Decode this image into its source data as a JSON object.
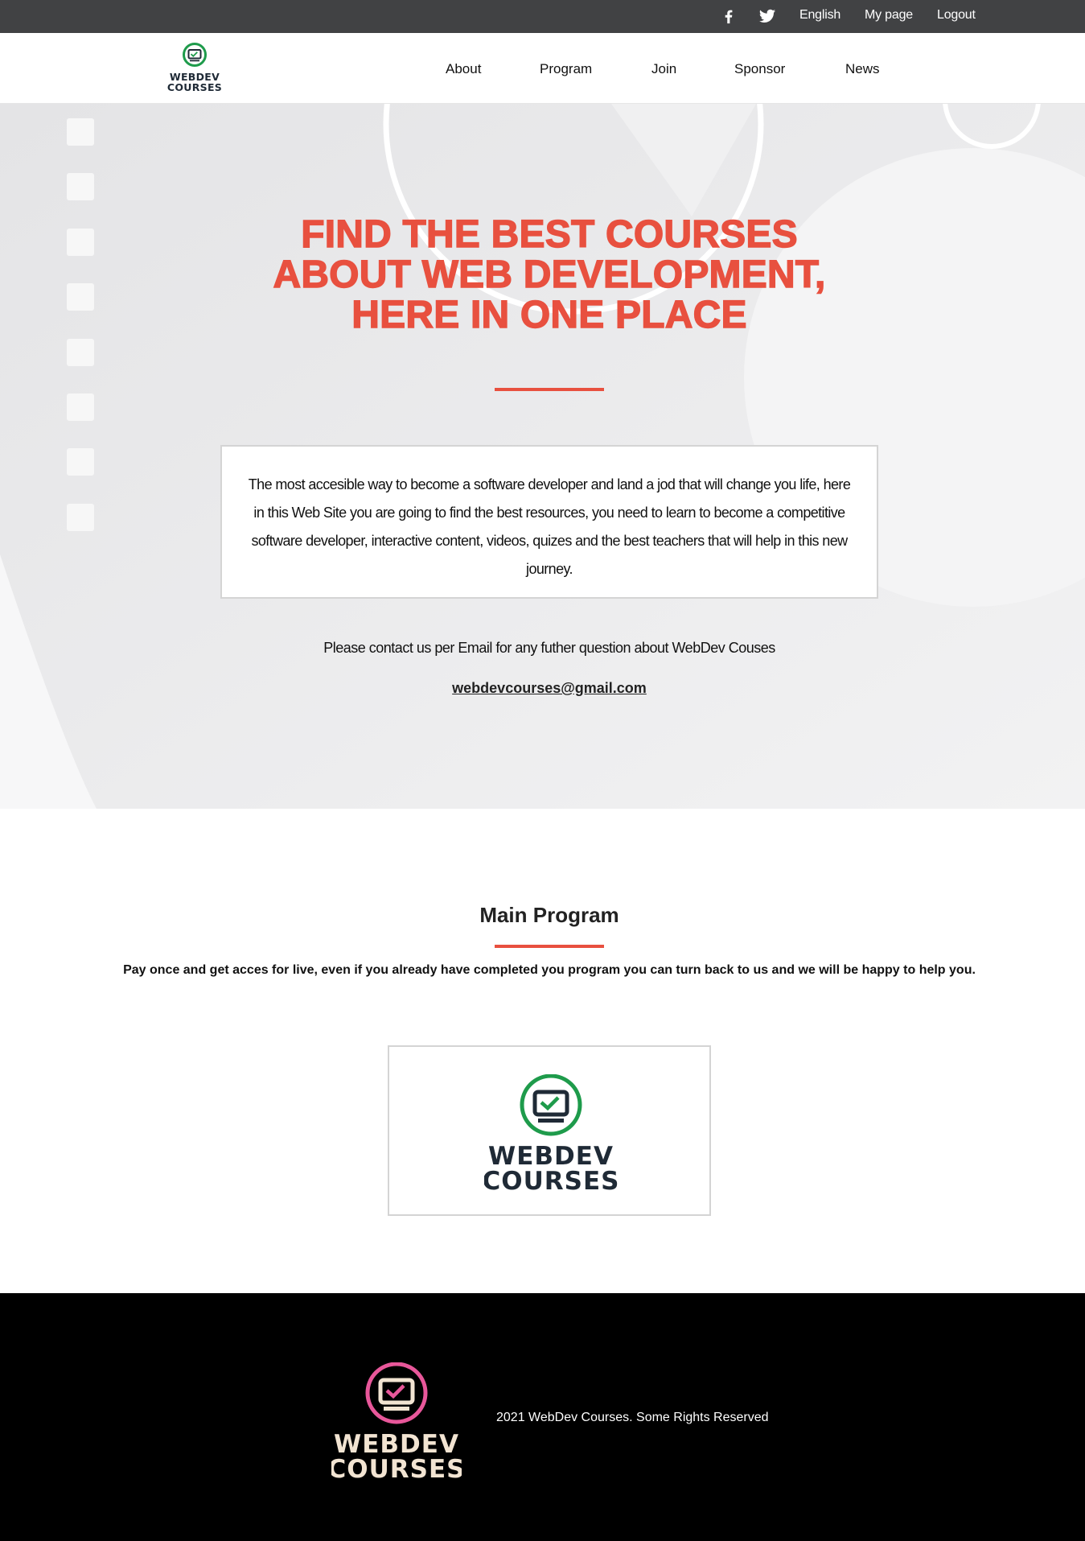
{
  "topbar": {
    "social": [
      {
        "icon": "facebook-icon"
      },
      {
        "icon": "twitter-icon"
      }
    ],
    "links": {
      "language": "English",
      "my_page": "My page",
      "logout": "Logout"
    }
  },
  "brand": {
    "line1": "WEBDEV",
    "line2": "COURSES",
    "icon": "monitor-check-icon",
    "colors": {
      "ring": "#1e9b4b",
      "text": "#1f2a36",
      "footer_ring": "#e8579a",
      "footer_text": "#f2e4d2"
    }
  },
  "nav": {
    "items": [
      "About",
      "Program",
      "Join",
      "Sponsor",
      "News"
    ]
  },
  "hero": {
    "title_line1": "FIND THE BEST COURSES",
    "title_line2": "ABOUT WEB DEVELOPMENT,",
    "title_line3": "HERE IN ONE PLACE",
    "description": "The most accesible way to become a software developer and land a jod that will change you life, here in this Web Site you are going to find the best resources, you need to learn to become a competitive software developer, interactive content, videos, quizes and the best teachers that will help in this new journey.",
    "contact_text": "Please contact us per Email for any futher question about WebDev Couses",
    "email": "webdevcourses@gmail.com",
    "accent_color": "#e8503f"
  },
  "main_program": {
    "title": "Main Program",
    "subtitle": "Pay once and get acces for live, even if you already have completed you program you can turn back to us and we will be happy to help you."
  },
  "footer": {
    "copyright": "2021 WebDev Courses. Some Rights Reserved"
  }
}
